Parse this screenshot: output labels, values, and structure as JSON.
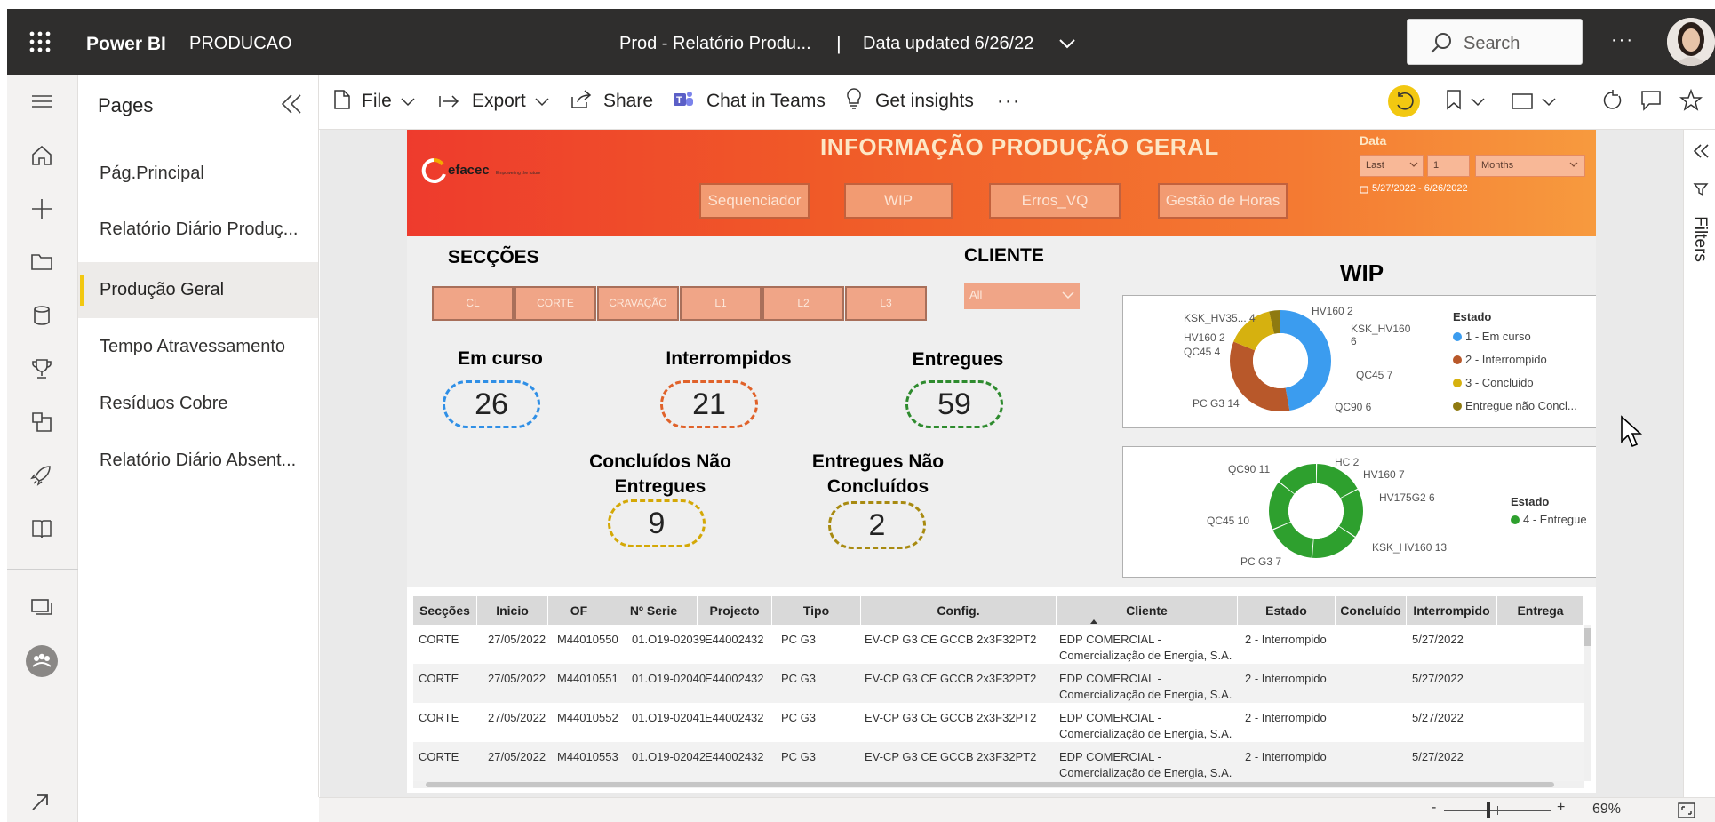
{
  "topbar": {
    "brand": "Power BI",
    "workspace": "PRODUCAO",
    "report_title": "Prod - Relatório Produ...",
    "separator": "|",
    "data_updated": "Data updated 6/26/22",
    "search_placeholder": "Search",
    "more": "···"
  },
  "pages_pane": {
    "title": "Pages",
    "items": [
      {
        "label": "Pág.Principal",
        "active": false
      },
      {
        "label": "Relatório Diário Produç...",
        "active": false
      },
      {
        "label": "Produção Geral",
        "active": true
      },
      {
        "label": "Tempo Atravessamento",
        "active": false
      },
      {
        "label": "Resíduos Cobre",
        "active": false
      },
      {
        "label": "Relatório Diário Absent...",
        "active": false
      }
    ]
  },
  "commandbar": {
    "file": "File",
    "export": "Export",
    "share": "Share",
    "chat": "Chat in Teams",
    "insights": "Get insights",
    "more": "···"
  },
  "report": {
    "banner_title": "INFORMAÇÃO PRODUÇÃO GERAL",
    "logo_text": "efacec",
    "logo_tagline": "Empowering the future",
    "nav_buttons": [
      "Sequenciador",
      "WIP",
      "Erros_VQ",
      "Gestão de Horas"
    ],
    "date_filter": {
      "label": "Data",
      "mode": "Last",
      "count": "1",
      "unit": "Months",
      "range": "5/27/2022 - 6/26/2022"
    },
    "sections_title": "SECÇÕES",
    "section_buttons": [
      "CL",
      "CORTE",
      "CRAVAÇÃO",
      "L1",
      "L2",
      "L3"
    ],
    "client_title": "CLIENTE",
    "client_value": "All",
    "kpis": [
      {
        "title": "Em curso",
        "value": "26",
        "color": "#2f8fe6"
      },
      {
        "title": "Interrompidos",
        "value": "21",
        "color": "#e0622a"
      },
      {
        "title": "Entregues",
        "value": "59",
        "color": "#2e8b2e"
      },
      {
        "title": "Concluídos Não Entregues",
        "value": "9",
        "color": "#d4a806"
      },
      {
        "title": "Entregues Não Concluídos",
        "value": "2",
        "color": "#a88a10"
      }
    ],
    "wip_title": "WIP",
    "donut1": {
      "legend_title": "Estado",
      "legend": [
        {
          "label": "1 - Em curso",
          "color": "#3b9cef"
        },
        {
          "label": "2 - Interrompido",
          "color": "#b8582a"
        },
        {
          "label": "3 - Concluido",
          "color": "#d6b10f"
        },
        {
          "label": "Entregue não Concl...",
          "color": "#8f7a10"
        }
      ],
      "labels": [
        "KSK_HV35... 4",
        "HV160 2",
        "KSK_HV160",
        "6",
        "HV160 2",
        "QC45 4",
        "QC45 7",
        "PC G3 14",
        "QC90 6"
      ]
    },
    "donut2": {
      "legend_title": "Estado",
      "legend": [
        {
          "label": "4 - Entregue",
          "color": "#2ea02e"
        }
      ],
      "labels": [
        "QC90 11",
        "HC 2",
        "HV160 7",
        "HV175G2 6",
        "QC45 10",
        "KSK_HV160 13",
        "PC G3 7"
      ]
    },
    "table": {
      "headers": [
        "Secções",
        "Inicio",
        "OF",
        "Nº Serie",
        "Projecto",
        "Tipo",
        "Config.",
        "Cliente",
        "Estado",
        "Concluído",
        "Interrompido",
        "Entrega"
      ],
      "rows": [
        [
          "CORTE",
          "27/05/2022",
          "M44010550",
          "01.O19-02039",
          "E44002432",
          "PC G3",
          "EV-CP G3 CE GCCB 2x3F32PT2",
          "EDP COMERCIAL -",
          "Comercialização de Energia, S.A.",
          "2 - Interrompido",
          "",
          "5/27/2022"
        ],
        [
          "CORTE",
          "27/05/2022",
          "M44010551",
          "01.O19-02040",
          "E44002432",
          "PC G3",
          "EV-CP G3 CE GCCB 2x3F32PT2",
          "EDP COMERCIAL -",
          "Comercialização de Energia, S.A.",
          "2 - Interrompido",
          "",
          "5/27/2022"
        ],
        [
          "CORTE",
          "27/05/2022",
          "M44010552",
          "01.O19-02041",
          "E44002432",
          "PC G3",
          "EV-CP G3 CE GCCB 2x3F32PT2",
          "EDP COMERCIAL -",
          "Comercialização de Energia, S.A.",
          "2 - Interrompido",
          "",
          "5/27/2022"
        ],
        [
          "CORTE",
          "27/05/2022",
          "M44010553",
          "01.O19-02042",
          "E44002432",
          "PC G3",
          "EV-CP G3 CE GCCB 2x3F32PT2",
          "EDP COMERCIAL -",
          "Comercialização de Energia, S.A.",
          "2 - Interrompido",
          "",
          "5/27/2022"
        ]
      ]
    }
  },
  "filters_pane": {
    "label": "Filters"
  },
  "statusbar": {
    "zoom": "69%",
    "minus": "-",
    "plus": "+"
  }
}
